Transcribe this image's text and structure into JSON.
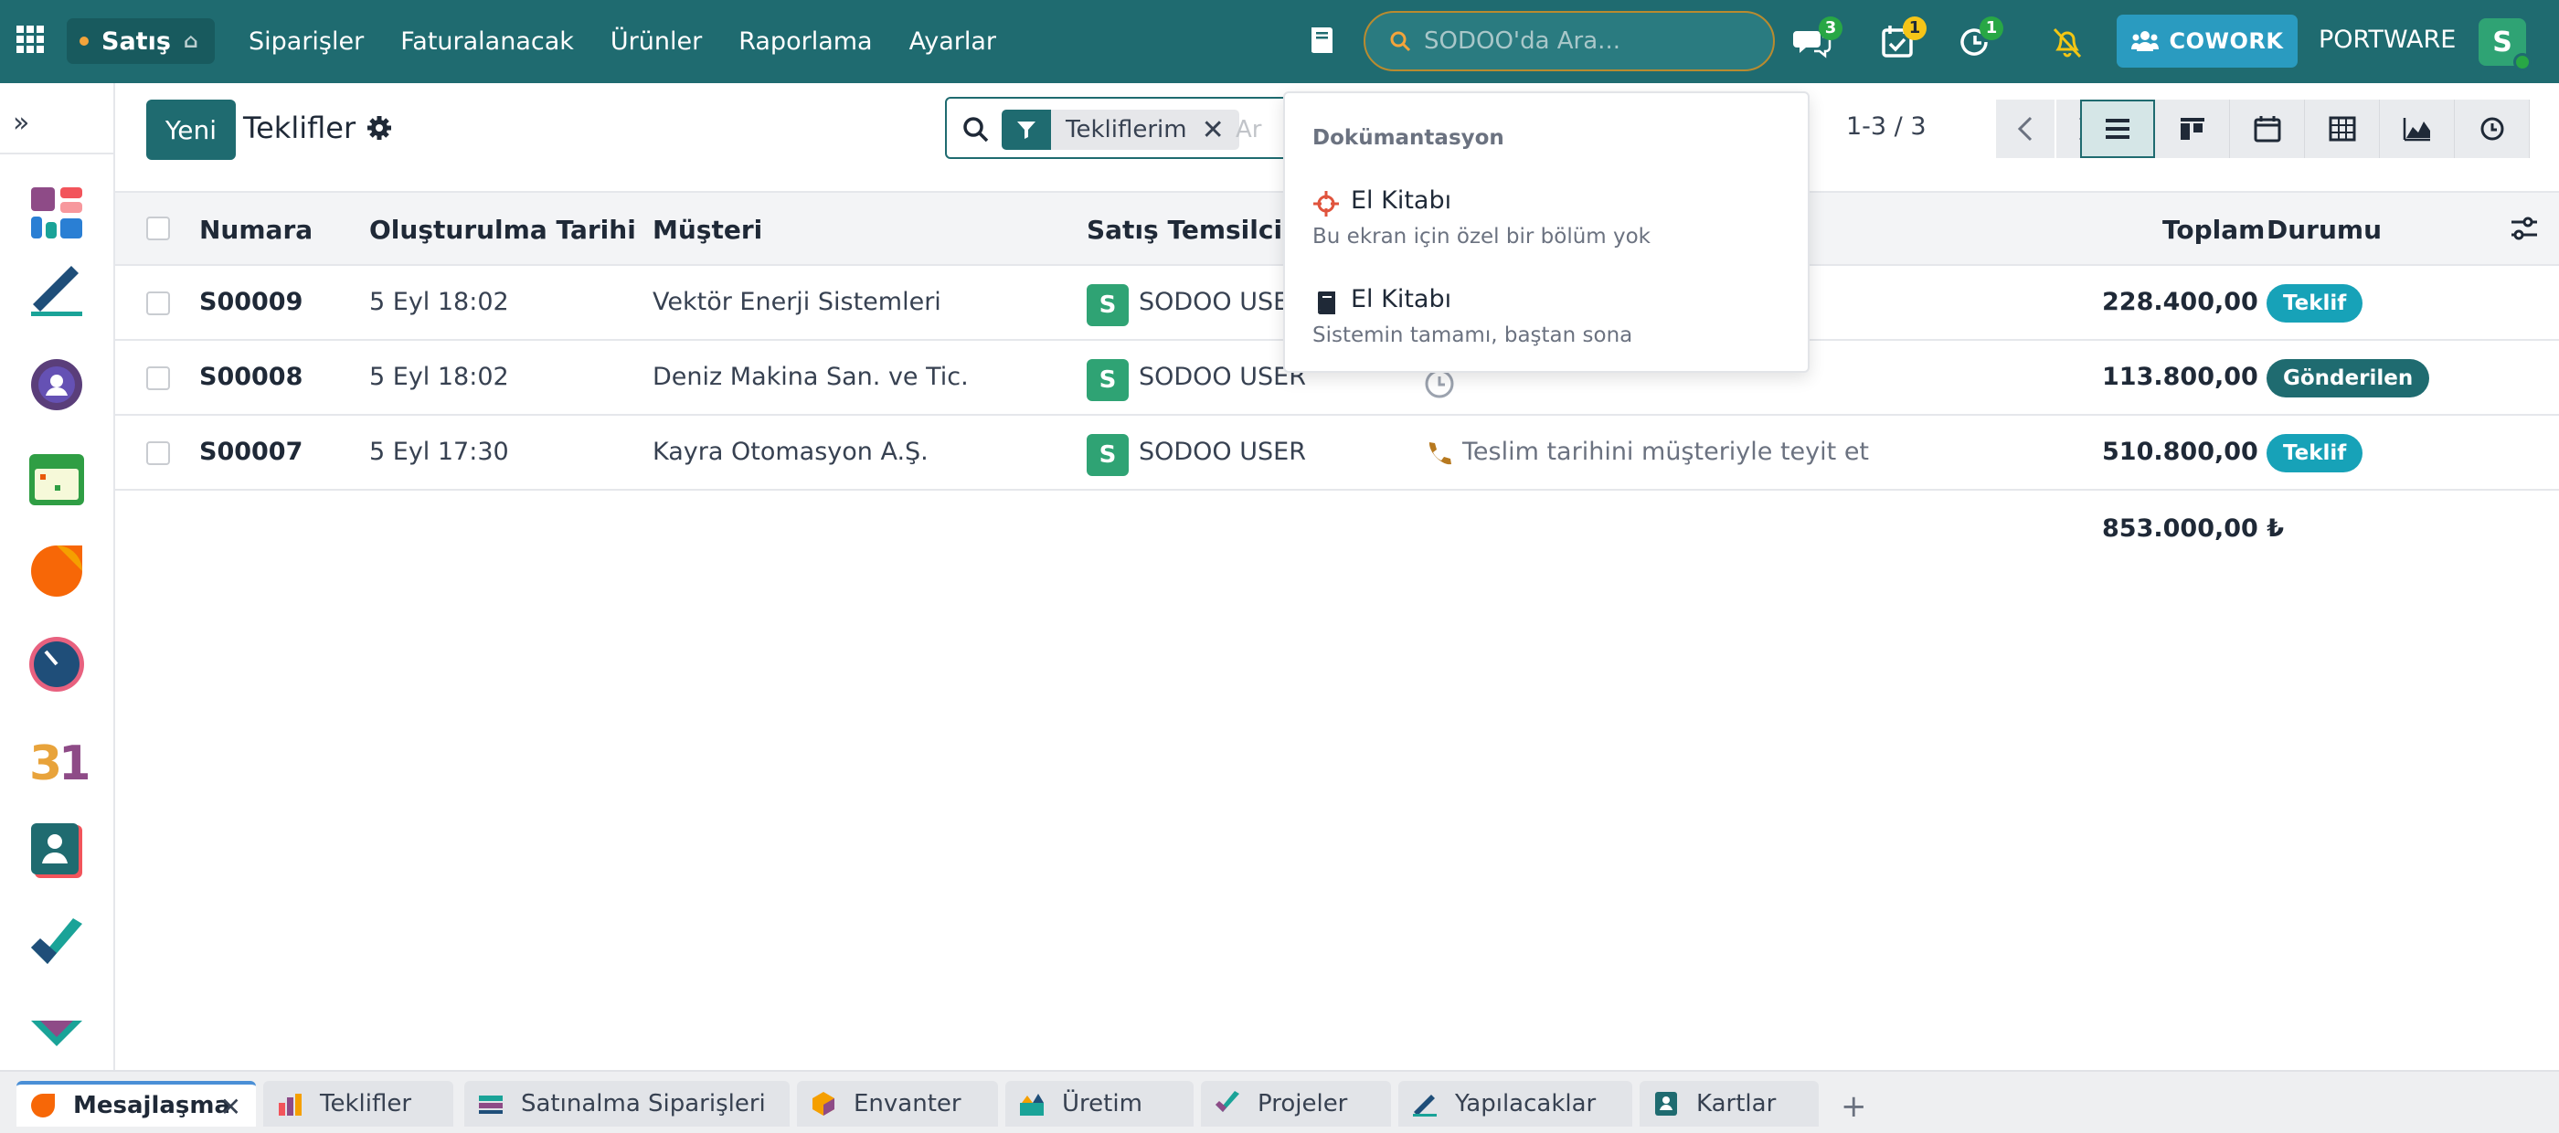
{
  "navbar": {
    "app_name": "Satış",
    "menu": [
      "Siparişler",
      "Faturalanacak",
      "Ürünler",
      "Raporlama",
      "Ayarlar"
    ],
    "search_placeholder": "SODOO'da Ara...",
    "messages_count": "3",
    "activities_count": "1",
    "timer_count": "1",
    "cowork_label": "COWORK",
    "company": "PORTWARE",
    "user_initial": "S"
  },
  "control": {
    "new_button": "Yeni",
    "title": "Teklifler",
    "facet_label": "Tekliflerim",
    "search_placeholder_partial": "Ar",
    "pager": "1-3 / 3"
  },
  "table": {
    "headers": {
      "number": "Numara",
      "created": "Oluşturulma Tarihi",
      "customer": "Müşteri",
      "salesperson": "Satış Temsilcisi",
      "total": "Toplam",
      "status": "Durumu"
    },
    "rows": [
      {
        "number": "S00009",
        "created": "5 Eyl 18:02",
        "customer": "Vektör Enerji Sistemleri",
        "salesperson_initial": "S",
        "salesperson": "SODOO USER",
        "activity": "",
        "total": "228.400,00 ₺",
        "status": "Teklif",
        "status_style": "info"
      },
      {
        "number": "S00008",
        "created": "5 Eyl 18:02",
        "customer": "Deniz Makina San. ve Tic.",
        "salesperson_initial": "S",
        "salesperson": "SODOO USER",
        "activity": "",
        "total": "113.800,00 ₺",
        "status": "Gönderilen",
        "status_style": "dark"
      },
      {
        "number": "S00007",
        "created": "5 Eyl 17:30",
        "customer": "Kayra Otomasyon A.Ş.",
        "salesperson_initial": "S",
        "salesperson": "SODOO USER",
        "activity": "Teslim tarihini müşteriyle teyit et",
        "total": "510.800,00 ₺",
        "status": "Teklif",
        "status_style": "info"
      }
    ],
    "grand_total": "853.000,00 ₺"
  },
  "dropdown": {
    "header": "Dokümantasyon",
    "items": [
      {
        "title": "El Kitabı",
        "subtitle": "Bu ekran için özel bir bölüm yok",
        "icon": "crosshair-icon"
      },
      {
        "title": "El Kitabı",
        "subtitle": "Sistemin tamamı, baştan sona",
        "icon": "book-icon"
      }
    ]
  },
  "tabs": [
    {
      "label": "Mesajlaşma",
      "active": true
    },
    {
      "label": "Teklifler",
      "active": false
    },
    {
      "label": "Satınalma Siparişleri",
      "active": false
    },
    {
      "label": "Envanter",
      "active": false
    },
    {
      "label": "Üretim",
      "active": false
    },
    {
      "label": "Projeler",
      "active": false
    },
    {
      "label": "Yapılacaklar",
      "active": false
    },
    {
      "label": "Kartlar",
      "active": false
    }
  ],
  "colors": {
    "brand": "#1f6b70",
    "info_badge": "#17a2b8",
    "cowork": "#2a9bc0"
  }
}
